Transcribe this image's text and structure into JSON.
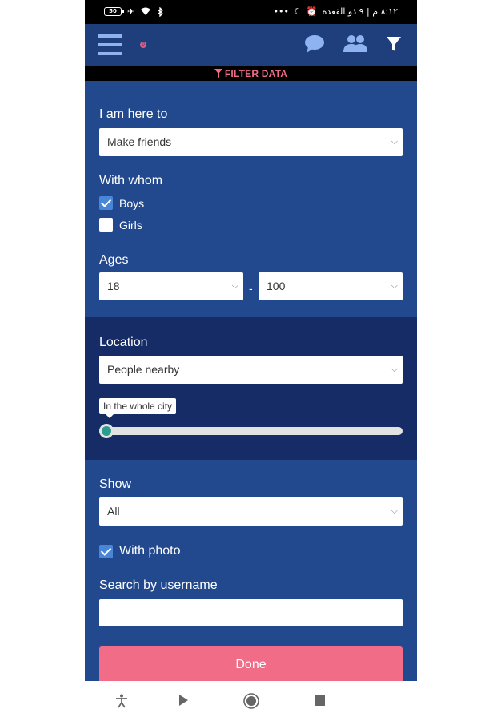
{
  "status_bar": {
    "battery": "50",
    "time_text": "٨:١٢ م | ٩ ذو القعدة"
  },
  "header": {
    "notification_badge": "0"
  },
  "filter_bar": {
    "label": "FILTER DATA"
  },
  "form": {
    "purpose": {
      "label": "I am here to",
      "value": "Make friends"
    },
    "with_whom": {
      "label": "With whom",
      "options": [
        {
          "label": "Boys",
          "checked": true
        },
        {
          "label": "Girls",
          "checked": false
        }
      ]
    },
    "ages": {
      "label": "Ages",
      "min": "18",
      "separator": "-",
      "max": "100"
    },
    "location": {
      "label": "Location",
      "value": "People nearby",
      "slider_label": "In the whole city",
      "slider_value": 0
    },
    "show": {
      "label": "Show",
      "value": "All"
    },
    "with_photo": {
      "label": "With photo",
      "checked": true
    },
    "search": {
      "label": "Search by username",
      "value": ""
    },
    "done_button": "Done"
  },
  "colors": {
    "header_bg": "#1e3f7c",
    "section_bg": "#22498d",
    "location_bg": "#152c66",
    "accent_pink": "#f06c87",
    "slider_thumb": "#2a9d8f"
  },
  "icons": {
    "header": [
      "menu-icon",
      "chat-icon",
      "people-icon",
      "filter-icon"
    ],
    "nav": [
      "accessibility-icon",
      "play-icon",
      "record-icon",
      "stop-icon"
    ]
  }
}
